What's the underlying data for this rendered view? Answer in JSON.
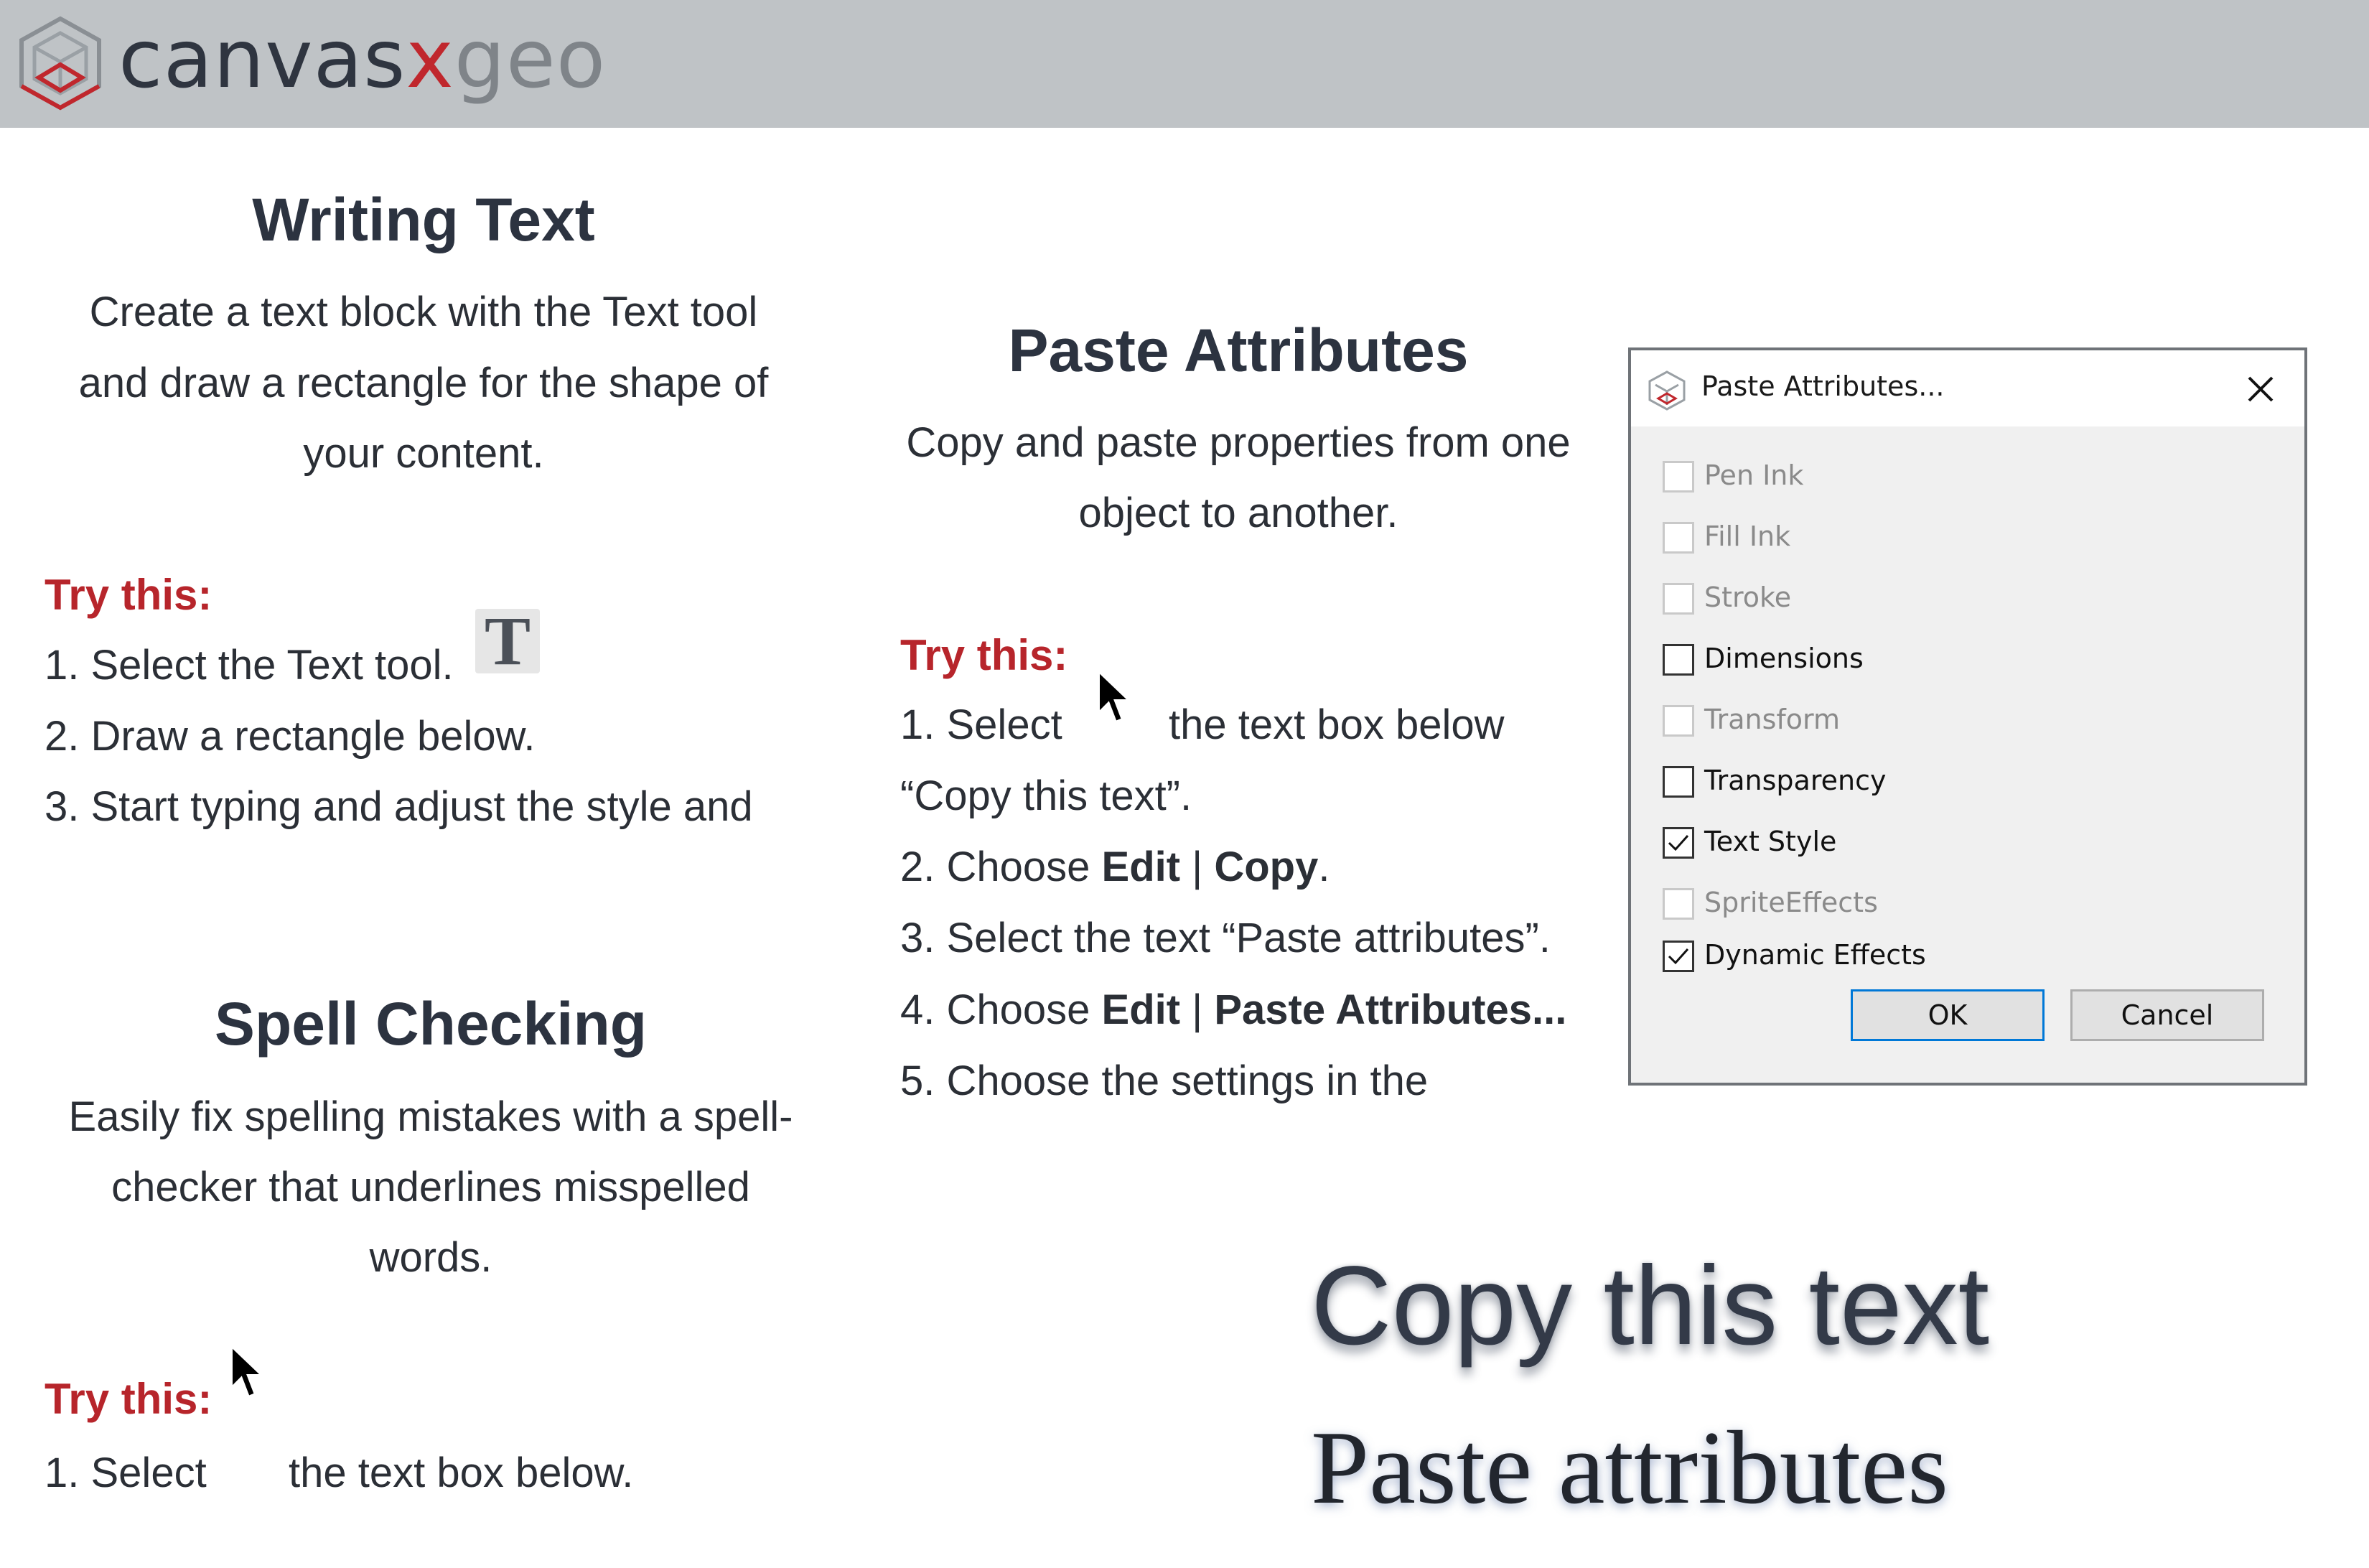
{
  "brand": {
    "part1": "canvas",
    "part2": "x",
    "part3": "geo"
  },
  "colors": {
    "accent_red": "#b7252b",
    "header_bar": "#bfc3c6",
    "text_dark": "#2b2f36"
  },
  "writing": {
    "title": "Writing Text",
    "line1": "Create a text block with the Text tool",
    "line2": "and draw a rectangle for the shape of",
    "line3": "your content.",
    "try": "Try this:",
    "steps": [
      "1. Select the Text tool.",
      "2. Draw a rectangle below.",
      "3. Start typing and adjust the style and"
    ],
    "tool_icon": "T"
  },
  "spell": {
    "title": "Spell Checking",
    "line1": "Easily fix spelling mistakes with a spell-",
    "line2": "checker that underlines misspelled",
    "line3": "words.",
    "try": "Try this:",
    "step1_a": "1. Select",
    "step1_b": "the text box below."
  },
  "paste": {
    "title": "Paste Attributes",
    "line1": "Copy and paste properties from one",
    "line2": "object to another.",
    "try": "Try this:",
    "step1_a": "1. Select",
    "step1_b": "the text box below",
    "step1_c": "“Copy this text”.",
    "step2_a": "2. Choose ",
    "step2_b": "Edit",
    "step2_c": " | ",
    "step2_d": "Copy",
    "step2_e": ".",
    "step3": "3. Select the text “Paste attributes”.",
    "step4_a": "4. Choose ",
    "step4_b": "Edit",
    "step4_c": " | ",
    "step4_d": "Paste Attributes...",
    "step5": "5. Choose the settings in the"
  },
  "dialog": {
    "title": "Paste Attributes...",
    "options": [
      {
        "label": "Pen Ink",
        "checked": false,
        "enabled": false
      },
      {
        "label": "Fill Ink",
        "checked": false,
        "enabled": false
      },
      {
        "label": "Stroke",
        "checked": false,
        "enabled": false
      },
      {
        "label": "Dimensions",
        "checked": false,
        "enabled": true
      },
      {
        "label": "Transform",
        "checked": false,
        "enabled": false
      },
      {
        "label": "Transparency",
        "checked": false,
        "enabled": true
      },
      {
        "label": "Text Style",
        "checked": true,
        "enabled": true
      },
      {
        "label": "SpriteEffects",
        "checked": false,
        "enabled": false
      },
      {
        "label": "Dynamic Effects",
        "checked": true,
        "enabled": true
      }
    ],
    "ok_label": "OK",
    "cancel_label": "Cancel"
  },
  "samples": {
    "copy_text": "Copy this text",
    "paste_text": "Paste attributes"
  }
}
